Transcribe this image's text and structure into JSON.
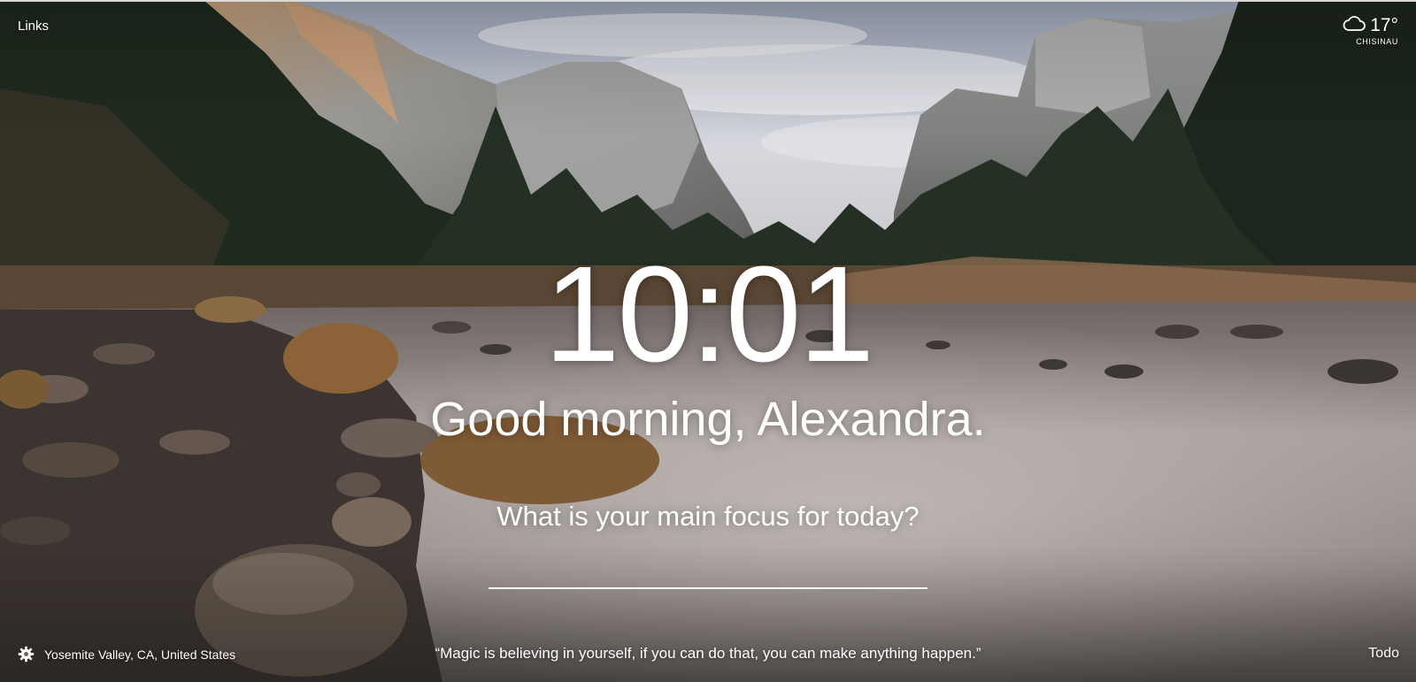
{
  "top_left": {
    "links_label": "Links"
  },
  "weather": {
    "icon": "cloud-icon",
    "temperature": "17°",
    "city": "CHISINAU"
  },
  "clock": {
    "time": "10:01"
  },
  "greeting": {
    "text": "Good morning, Alexandra."
  },
  "focus": {
    "question": "What is your main focus for today?",
    "input_value": ""
  },
  "bottom": {
    "settings_icon": "gear-icon",
    "location": "Yosemite Valley, CA, United States",
    "quote": "“Magic is believing in yourself, if you can do that, you can make anything happen.”",
    "todo_label": "Todo"
  },
  "background": {
    "description_colors": {
      "sky": "#c9ccd6",
      "mountain": "#8d8f90",
      "forest": "#1f2a1e",
      "river": "#8a807c",
      "rock": "#3a3431",
      "grass": "#8a6238"
    }
  }
}
